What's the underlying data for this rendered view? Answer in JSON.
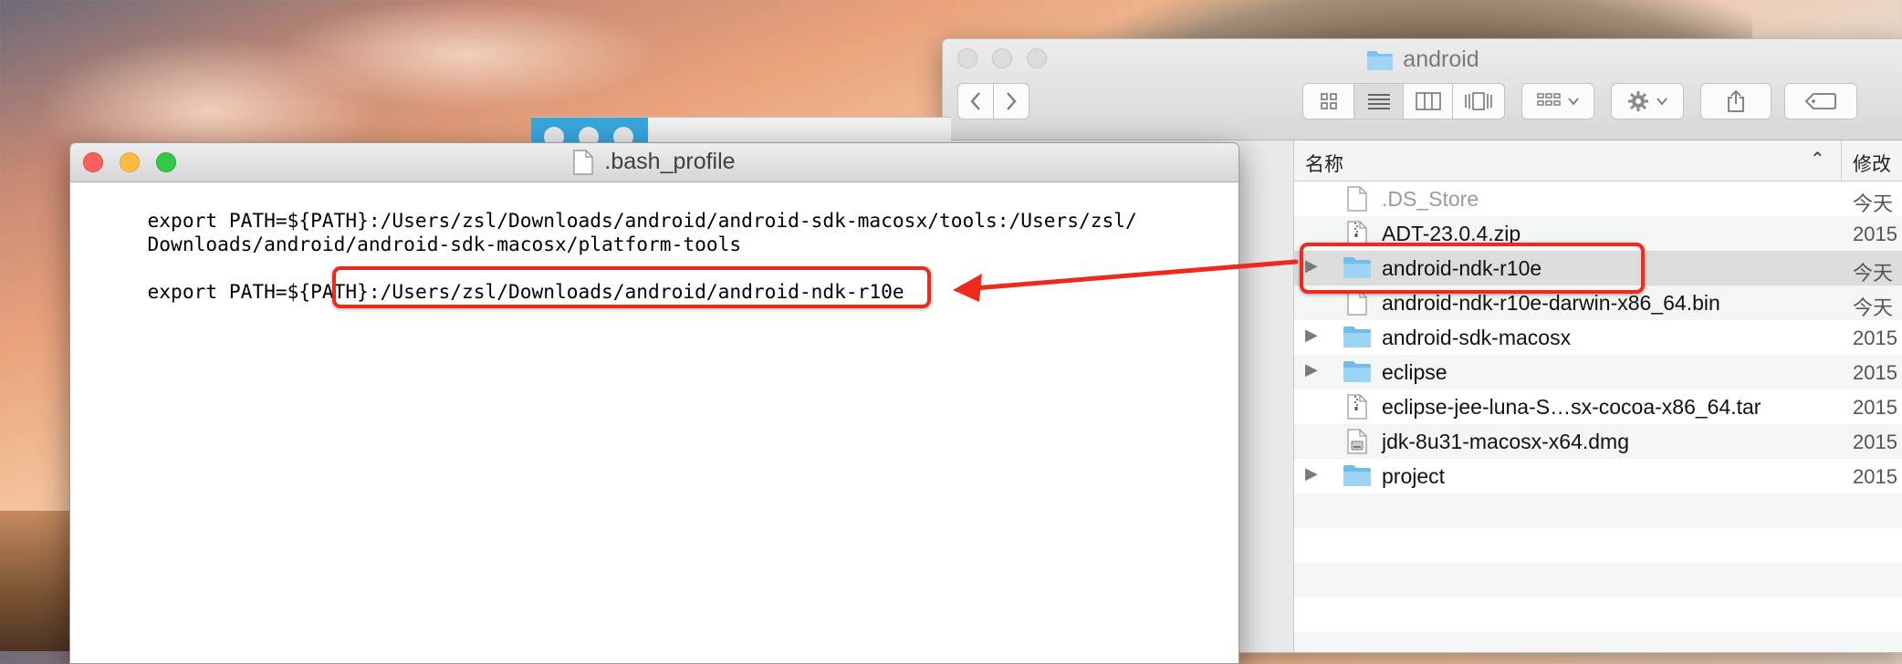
{
  "finder": {
    "title": "android",
    "view_buttons": [
      "icon-view",
      "list-view",
      "column-view",
      "cover-flow-view"
    ],
    "columns": {
      "name": "名称",
      "modified": "修改"
    },
    "rows": [
      {
        "name": ".DS_Store",
        "date": "今天",
        "kind": "document",
        "disclosure": false
      },
      {
        "name": "ADT-23.0.4.zip",
        "date": "2015",
        "kind": "zip",
        "disclosure": false
      },
      {
        "name": "android-ndk-r10e",
        "date": "今天",
        "kind": "folder",
        "disclosure": true,
        "selected": true
      },
      {
        "name": "android-ndk-r10e-darwin-x86_64.bin",
        "date": "今天",
        "kind": "document",
        "disclosure": false
      },
      {
        "name": "android-sdk-macosx",
        "date": "2015",
        "kind": "folder",
        "disclosure": true
      },
      {
        "name": "eclipse",
        "date": "2015",
        "kind": "folder",
        "disclosure": true
      },
      {
        "name": "eclipse-jee-luna-S…sx-cocoa-x86_64.tar",
        "date": "2015",
        "kind": "zip",
        "disclosure": false
      },
      {
        "name": "jdk-8u31-macosx-x64.dmg",
        "date": "2015",
        "kind": "dmg",
        "disclosure": false
      },
      {
        "name": "project",
        "date": "2015",
        "kind": "folder",
        "disclosure": true
      }
    ]
  },
  "editor": {
    "title": ".bash_profile",
    "line1": "export PATH=${PATH}:/Users/zsl/Downloads/android/android-sdk-macosx/tools:/Users/zsl/",
    "line2": "Downloads/android/android-sdk-macosx/platform-tools",
    "line3_prefix": "export PATH=${PATH}:",
    "line3_path": "/Users/zsl/Downloads/android/android-ndk-r10e"
  },
  "annotation": {
    "color": "#ee2a1c"
  }
}
